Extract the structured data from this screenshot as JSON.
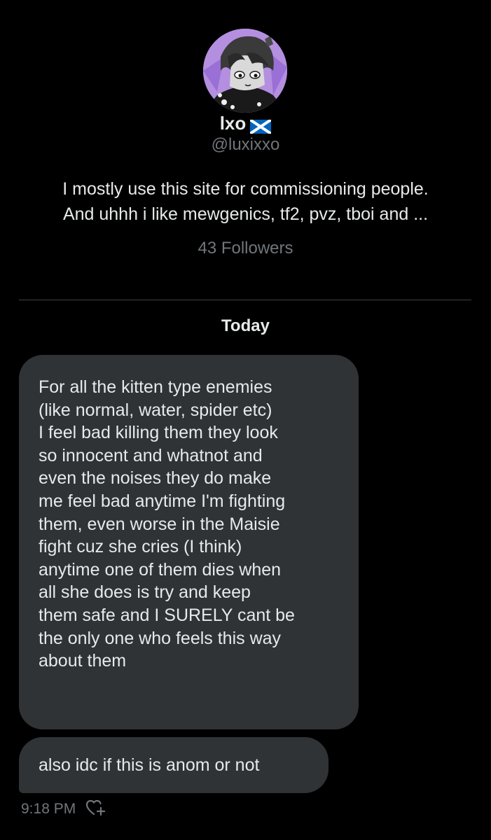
{
  "profile": {
    "display_name": "lxo",
    "name_flag_icon": "scotland-flag-icon",
    "handle": "@luxixxo",
    "bio_lines": [
      "I mostly use this site for commissioning people.",
      "And uhhh i like mewgenics, tf2, pvz, tboi and ..."
    ],
    "followers": "43 Followers"
  },
  "conversation": {
    "day_label": "Today",
    "messages": [
      {
        "lines": [
          "For all the kitten type enemies",
          "(like normal, water, spider etc)",
          "I feel bad killing them they look",
          "so innocent and whatnot and",
          "even the noises they do make",
          "me feel bad anytime I'm fighting",
          "them, even worse in the Maisie",
          "fight cuz she cries (I think)",
          "anytime one of them dies when",
          "all she does is try and keep",
          "them safe and I SURELY cant be",
          "the only one who feels this way",
          "about them"
        ]
      },
      {
        "text": "also idc if this is anom or not"
      }
    ],
    "timestamp": "9:18 PM",
    "react_icon": "add-reaction-heart-icon"
  },
  "colors": {
    "background": "#000000",
    "bubble": "#2f3336",
    "text_primary": "#e7e9ea",
    "text_secondary": "#71767b",
    "divider": "#3e4144",
    "flag_blue": "#0065bd",
    "avatar_accent": "#b48fe0"
  }
}
